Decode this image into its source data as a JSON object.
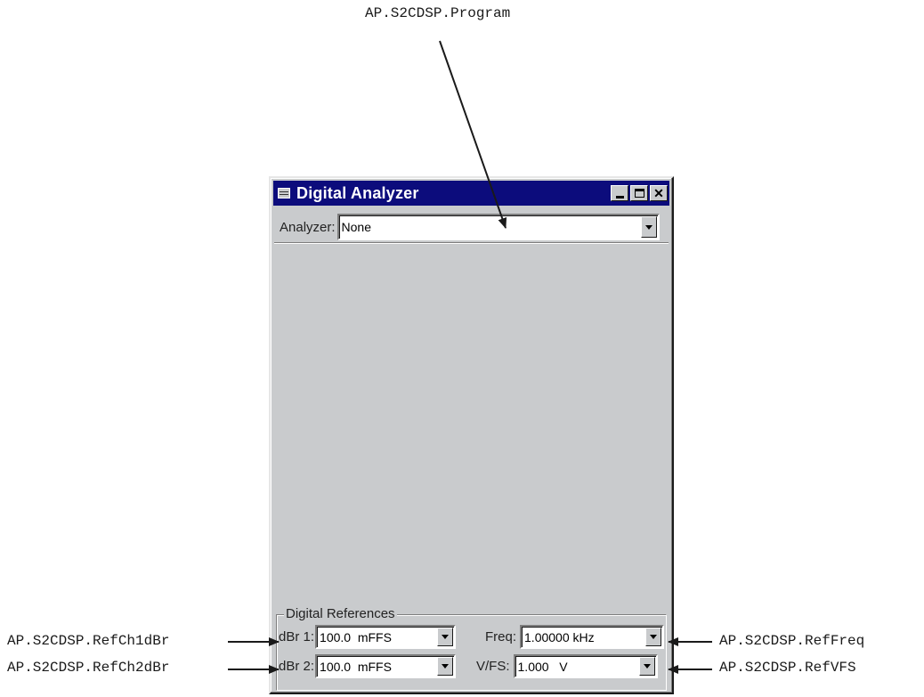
{
  "callouts": {
    "program": "AP.S2CDSP.Program",
    "ref_ch1_dbr": "AP.S2CDSP.RefCh1dBr",
    "ref_ch2_dbr": "AP.S2CDSP.RefCh2dBr",
    "ref_freq": "AP.S2CDSP.RefFreq",
    "ref_vfs": "AP.S2CDSP.RefVFS"
  },
  "window": {
    "title": "Digital Analyzer",
    "close_glyph": "✕"
  },
  "analyzer": {
    "label": "Analyzer:",
    "value": "None"
  },
  "references": {
    "group_label": "Digital References",
    "dbr1_label": "dBr 1:",
    "dbr1_value": "100.0  mFFS",
    "dbr2_label": "dBr 2:",
    "dbr2_value": "100.0  mFFS",
    "freq_label": "Freq:",
    "freq_value": "1.00000 kHz",
    "vfs_label": "V/FS:",
    "vfs_value": "1.000   V"
  },
  "colors": {
    "titlebar": "#0c0c7c",
    "window_face": "#c9cbcd"
  }
}
